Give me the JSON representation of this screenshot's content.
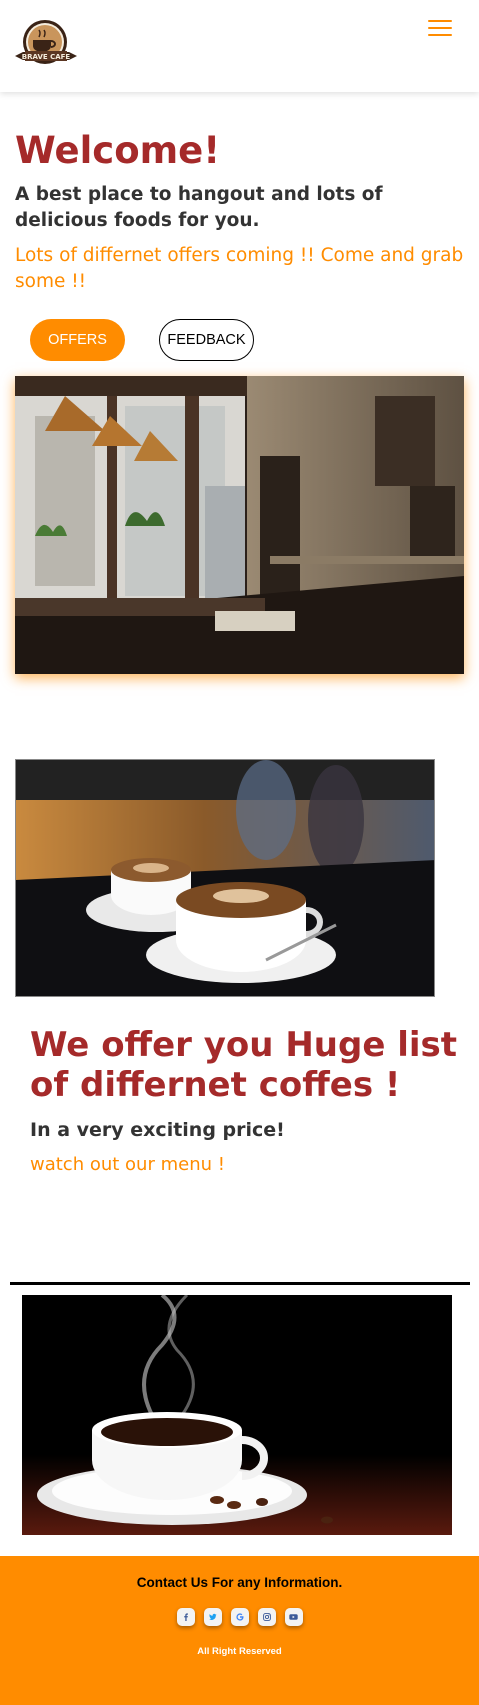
{
  "header": {
    "logo_text": "BRAVE CAFE",
    "menu_icon": "hamburger-menu-icon"
  },
  "hero": {
    "title": "Welcome!",
    "tagline": "A best place to hangout and lots of delicious foods for you.",
    "offers_text": "Lots of differnet offers coming !! Come and grab some !!",
    "offers_button": "OFFERS",
    "feedback_button": "FEEDBACK"
  },
  "menu_section": {
    "title": "We offer you Huge list of differnet coffes !",
    "subtitle": "In a very exciting price!",
    "link": "watch out our menu !"
  },
  "footer": {
    "contact": "Contact Us For any Information.",
    "socials": [
      "facebook-icon",
      "twitter-icon",
      "google-icon",
      "instagram-icon",
      "youtube-icon"
    ],
    "rights": "All Right Reserved"
  },
  "colors": {
    "accent": "#ff8c00",
    "heading": "#a52a2a",
    "text": "#333333"
  }
}
